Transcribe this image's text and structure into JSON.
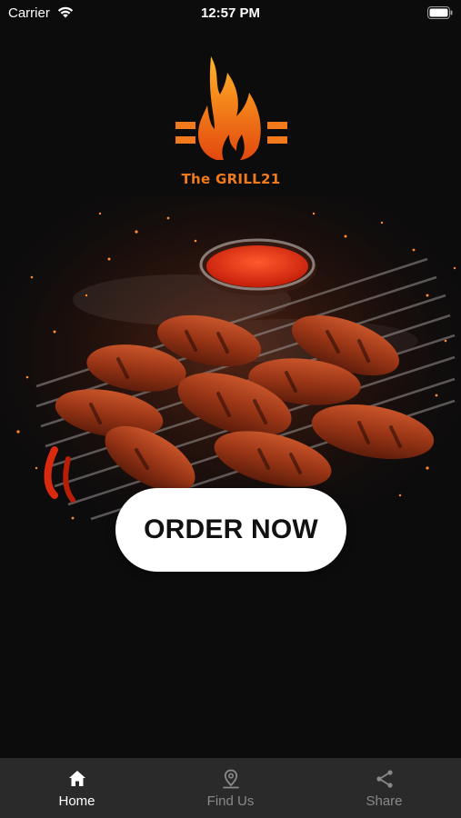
{
  "status_bar": {
    "carrier": "Carrier",
    "time": "12:57 PM"
  },
  "logo": {
    "text": "The GRILL21"
  },
  "hero": {
    "image": "grilled-chicken-wings-with-sauce"
  },
  "order_button": {
    "label": "ORDER NOW"
  },
  "tabs": [
    {
      "label": "Home",
      "icon": "home-icon",
      "active": true
    },
    {
      "label": "Find Us",
      "icon": "location-pin-icon",
      "active": false
    },
    {
      "label": "Share",
      "icon": "share-icon",
      "active": false
    }
  ],
  "colors": {
    "background": "#0c0c0d",
    "tab_bar": "#2a2a2b",
    "accent": "#f07a1c",
    "tab_inactive": "#8a8a8d"
  }
}
